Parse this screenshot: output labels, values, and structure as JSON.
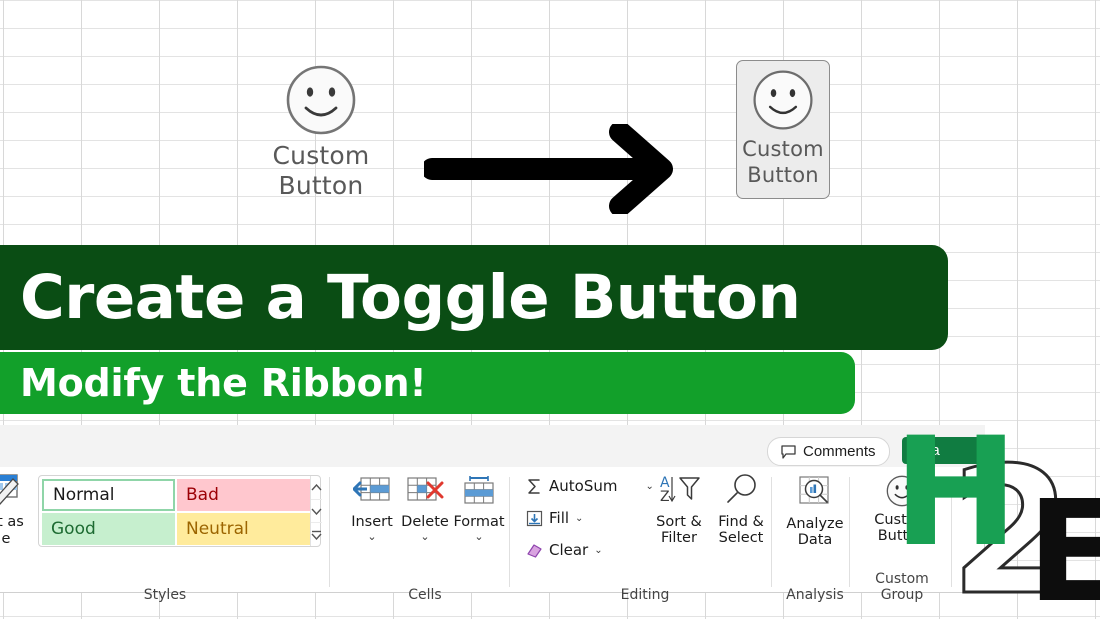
{
  "illustration": {
    "plain_button": {
      "icon": "smiley-face-icon",
      "label_line1": "Custom",
      "label_line2": "Button",
      "state": "normal"
    },
    "arrow": {
      "icon": "arrow-right-icon"
    },
    "toggled_button": {
      "icon": "smiley-face-icon",
      "label_line1": "Custom",
      "label_line2": "Button",
      "state": "pressed"
    }
  },
  "banners": {
    "title": "Create a Toggle Button",
    "subtitle": "Modify the Ribbon!",
    "title_color": "#0a4d14",
    "subtitle_color": "#12a02a",
    "text_color": "#ffffff"
  },
  "ribbon": {
    "comments_button": {
      "label": "Comments",
      "icon": "comment-bubble-icon"
    },
    "share_button": {
      "label": "Sha",
      "icon": "share-icon",
      "color": "#107c41"
    },
    "collapse_icon": "chevron-down-icon",
    "groups": [
      {
        "name": "Styles",
        "label": "Styles",
        "format_as_table": {
          "icon": "format-as-table-icon",
          "label_line1": "at as",
          "label_line2": "e",
          "chevron": "chevron-down-icon"
        },
        "gallery": {
          "cells": [
            {
              "label": "Normal",
              "bg": "#ffffff",
              "fg": "#1a1a1a"
            },
            {
              "label": "Bad",
              "bg": "#ffc7ce",
              "fg": "#9c0006"
            },
            {
              "label": "Good",
              "bg": "#c6efce",
              "fg": "#1d6b32"
            },
            {
              "label": "Neutral",
              "bg": "#ffeb9c",
              "fg": "#9c6500"
            }
          ],
          "scroll_up_icon": "chevron-up-icon",
          "scroll_down_icon": "chevron-down-icon",
          "more_icon": "more-styles-icon"
        }
      },
      {
        "name": "Cells",
        "label": "Cells",
        "buttons": [
          {
            "label": "Insert",
            "icon": "insert-cells-icon",
            "chevron": "chevron-down-icon"
          },
          {
            "label": "Delete",
            "icon": "delete-cells-icon",
            "chevron": "chevron-down-icon"
          },
          {
            "label": "Format",
            "icon": "format-cells-icon",
            "chevron": "chevron-down-icon"
          }
        ]
      },
      {
        "name": "Editing",
        "label": "Editing",
        "small_buttons": [
          {
            "label": "AutoSum",
            "icon": "autosum-icon",
            "chevron": "chevron-down-icon"
          },
          {
            "label": "Fill",
            "icon": "fill-icon",
            "chevron": "chevron-down-icon"
          },
          {
            "label": "Clear",
            "icon": "clear-icon",
            "chevron": "chevron-down-icon"
          }
        ],
        "big_buttons": [
          {
            "label_line1": "Sort &",
            "label_line2": "Filter",
            "icon": "sort-filter-icon",
            "chevron": "chevron-down-icon"
          },
          {
            "label_line1": "Find &",
            "label_line2": "Select",
            "icon": "find-select-icon",
            "chevron": "chevron-down-icon"
          }
        ]
      },
      {
        "name": "Analysis",
        "label": "Analysis",
        "buttons": [
          {
            "label_line1": "Analyze",
            "label_line2": "Data",
            "icon": "analyze-data-icon"
          }
        ]
      },
      {
        "name": "Custom Group",
        "label": "Custom Group",
        "buttons": [
          {
            "label_line1": "Custom",
            "label_line2": "Button",
            "icon": "smiley-face-icon"
          }
        ]
      }
    ]
  },
  "logo": {
    "h": "H",
    "two": "2",
    "e": "E",
    "h_color": "#18a053",
    "e_color": "#0d0d0d"
  }
}
